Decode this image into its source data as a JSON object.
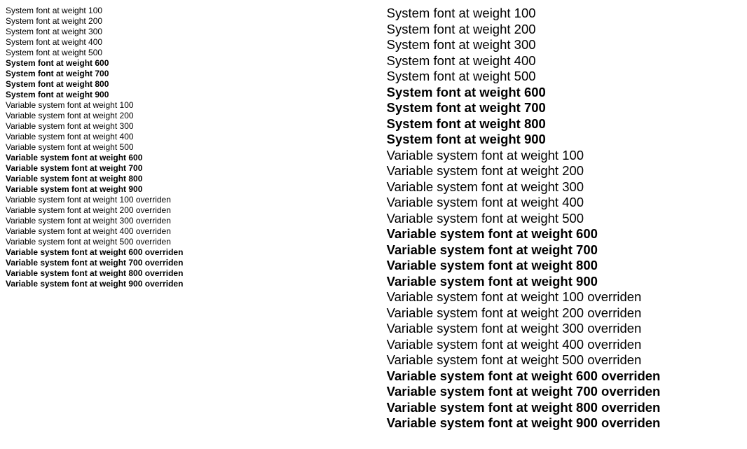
{
  "weights": [
    100,
    200,
    300,
    400,
    500,
    600,
    700,
    800,
    900
  ],
  "rows": [
    {
      "weight": 100,
      "text": "System font at weight 100"
    },
    {
      "weight": 200,
      "text": "System font at weight 200"
    },
    {
      "weight": 300,
      "text": "System font at weight 300"
    },
    {
      "weight": 400,
      "text": "System font at weight 400"
    },
    {
      "weight": 500,
      "text": "System font at weight 500"
    },
    {
      "weight": 600,
      "text": "System font at weight 600"
    },
    {
      "weight": 700,
      "text": "System font at weight 700"
    },
    {
      "weight": 800,
      "text": "System font at weight 800"
    },
    {
      "weight": 900,
      "text": "System font at weight 900"
    },
    {
      "weight": 100,
      "text": "Variable system font at weight 100"
    },
    {
      "weight": 200,
      "text": "Variable system font at weight 200"
    },
    {
      "weight": 300,
      "text": "Variable system font at weight 300"
    },
    {
      "weight": 400,
      "text": "Variable system font at weight 400"
    },
    {
      "weight": 500,
      "text": "Variable system font at weight 500"
    },
    {
      "weight": 600,
      "text": "Variable system font at weight 600"
    },
    {
      "weight": 700,
      "text": "Variable system font at weight 700"
    },
    {
      "weight": 800,
      "text": "Variable system font at weight 800"
    },
    {
      "weight": 900,
      "text": "Variable system font at weight 900"
    },
    {
      "weight": 100,
      "text": "Variable system font at weight 100 overriden"
    },
    {
      "weight": 200,
      "text": "Variable system font at weight 200 overriden"
    },
    {
      "weight": 300,
      "text": "Variable system font at weight 300 overriden"
    },
    {
      "weight": 400,
      "text": "Variable system font at weight 400 overriden"
    },
    {
      "weight": 500,
      "text": "Variable system font at weight 500 overriden"
    },
    {
      "weight": 600,
      "text": "Variable system font at weight 600 overriden"
    },
    {
      "weight": 700,
      "text": "Variable system font at weight 700 overriden"
    },
    {
      "weight": 800,
      "text": "Variable system font at weight 800 overriden"
    },
    {
      "weight": 900,
      "text": "Variable system font at weight 900 overriden"
    }
  ]
}
